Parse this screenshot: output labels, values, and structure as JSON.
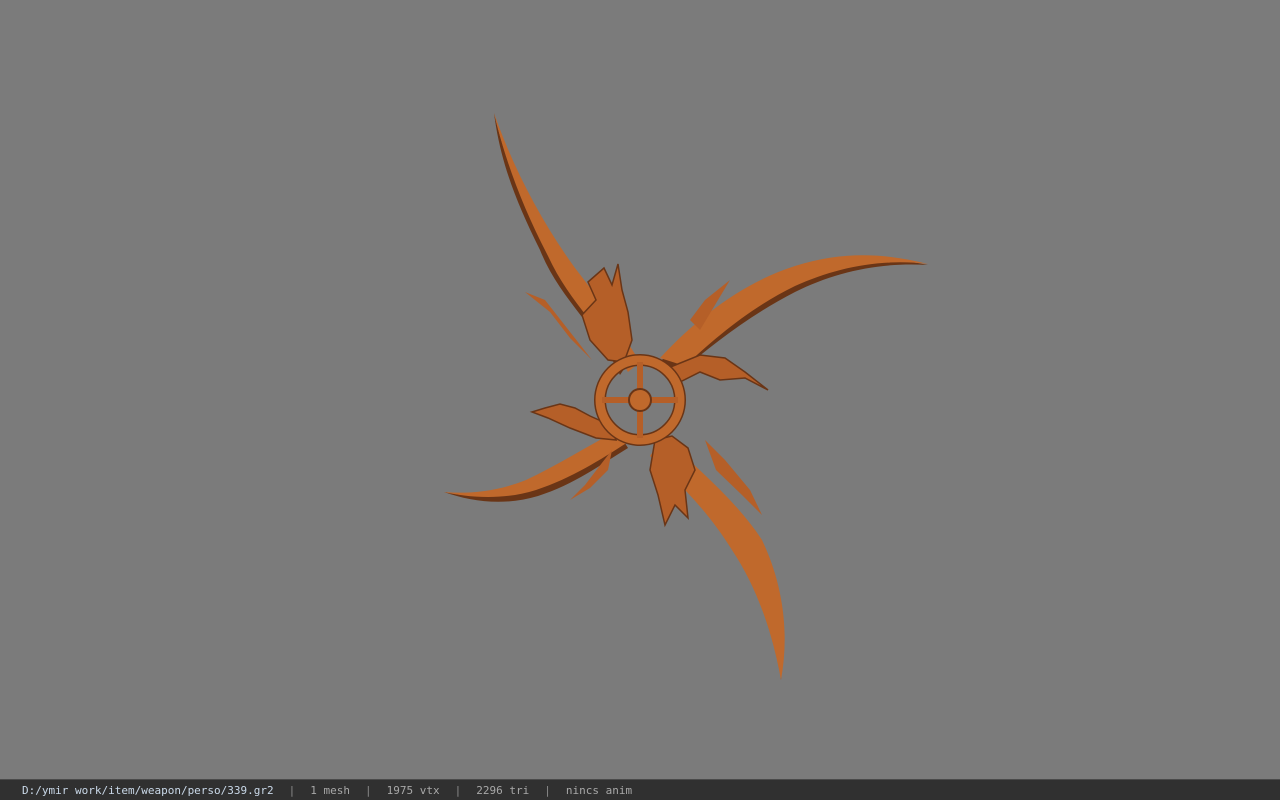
{
  "viewport": {
    "background_color": "#7b7b7b",
    "model": {
      "name": "throwing-star-weapon",
      "color": "#c0692c",
      "shadow_color": "#6a3516"
    }
  },
  "status_bar": {
    "file_path": "D:/ymir work/item/weapon/perso/339.gr2",
    "separator": "|",
    "mesh_count": "1 mesh",
    "vertex_count": "1975 vtx",
    "triangle_count": "2296 tri",
    "anim_status": "nincs anim"
  }
}
